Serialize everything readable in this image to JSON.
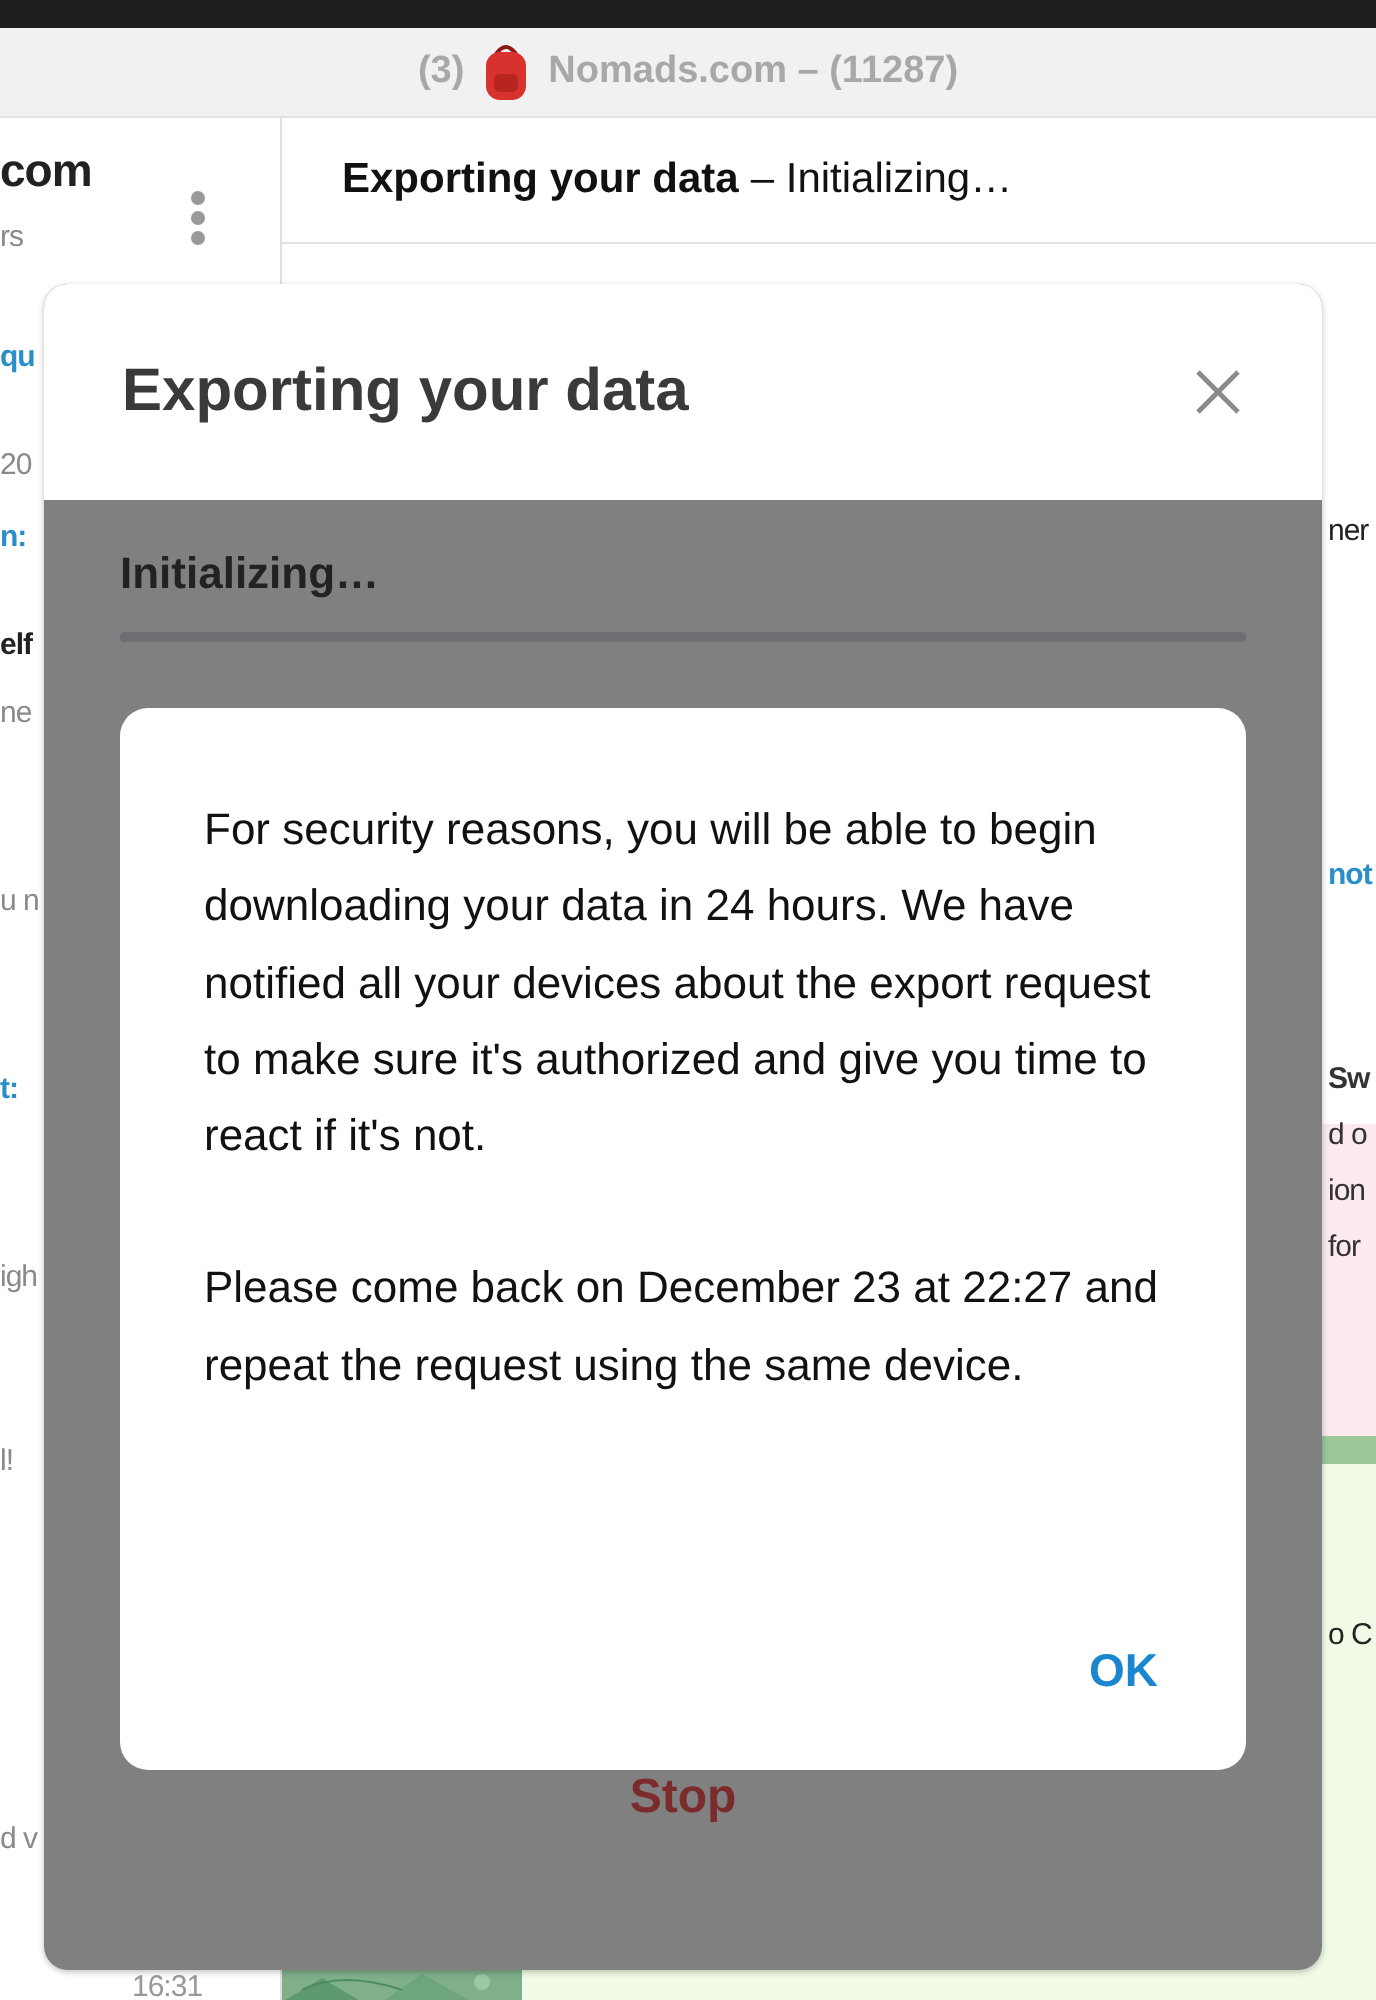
{
  "window": {
    "title_count": "(3)",
    "title": "Nomads.com – (11287)"
  },
  "sidebar": {
    "fragments": [
      {
        "kind": "title",
        "text": "com"
      },
      {
        "kind": "muted",
        "text": "rs"
      },
      {
        "kind": "link",
        "text": "qu"
      },
      {
        "kind": "muted",
        "text": "20"
      },
      {
        "kind": "link",
        "text": "n:"
      },
      {
        "kind": "bold",
        "text": "elf"
      },
      {
        "kind": "muted",
        "text": "ne"
      },
      {
        "kind": "muted",
        "text": "u n"
      },
      {
        "kind": "link",
        "text": "t:"
      },
      {
        "kind": "muted",
        "text": "igh"
      },
      {
        "kind": "muted",
        "text": "l!"
      },
      {
        "kind": "muted",
        "text": "d v"
      },
      {
        "kind": "time",
        "text": "16:31"
      }
    ]
  },
  "chat": {
    "header_title": "Exporting your data",
    "header_status": "– Initializing…",
    "fragments": [
      {
        "kind": "text",
        "text": "ner"
      },
      {
        "kind": "link",
        "text": "not"
      },
      {
        "kind": "pinned_bold",
        "text": "Sw"
      },
      {
        "kind": "pinned",
        "text": "d o"
      },
      {
        "kind": "pinned",
        "text": "ion"
      },
      {
        "kind": "pinned",
        "text": "for"
      },
      {
        "kind": "text",
        "text": "o C"
      }
    ]
  },
  "dialog": {
    "title": "Exporting your data",
    "status": "Initializing…",
    "level": 0,
    "stop_label": "Stop",
    "alert": {
      "paragraphs": [
        "For security reasons, you will be able to begin downloading your data in 24 hours. We have notified all your devices about the export request to make sure it's authorized and give you time to react if it's not.",
        "Please come back on December 23 at 22:27 and repeat the request using the same device."
      ],
      "button": "OK"
    }
  }
}
